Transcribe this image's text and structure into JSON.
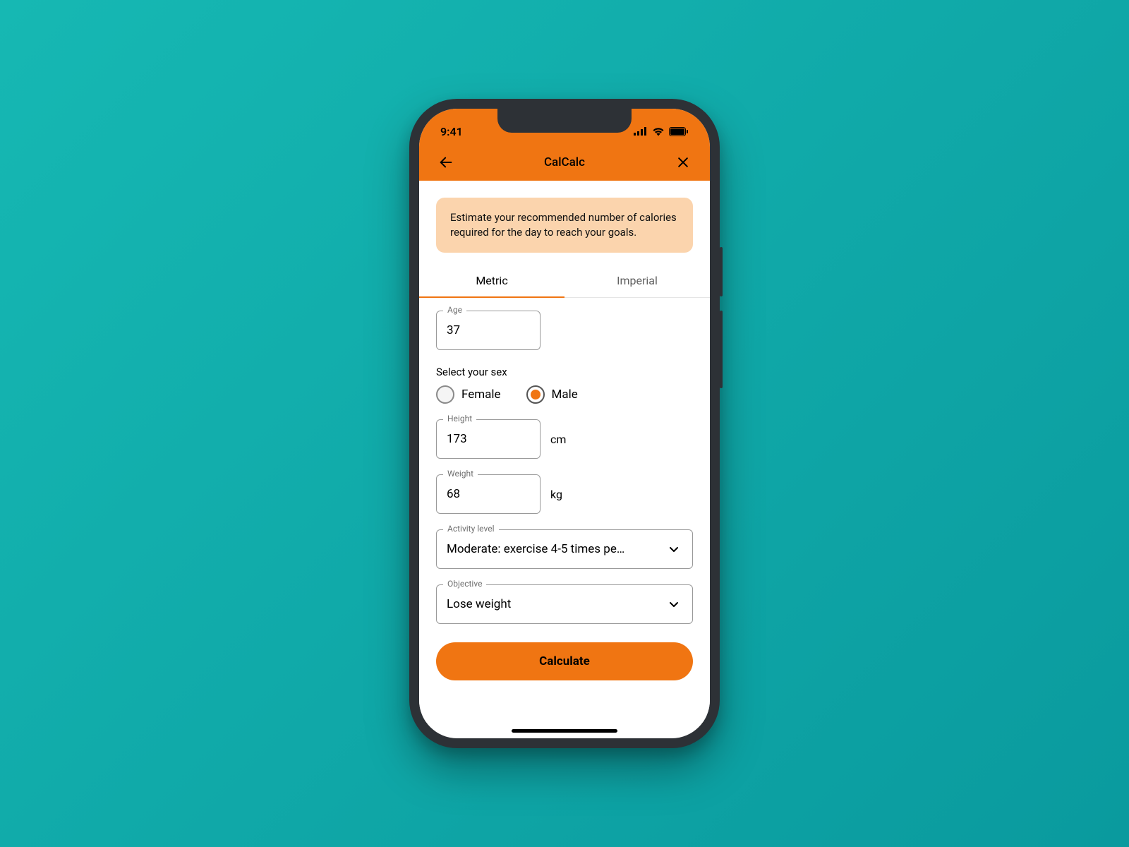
{
  "status": {
    "time": "9:41"
  },
  "nav": {
    "title": "CalCalc"
  },
  "info": {
    "text": "Estimate your recommended number of calories required for the day to reach your goals."
  },
  "tabs": {
    "metric": "Metric",
    "imperial": "Imperial",
    "active": "metric"
  },
  "form": {
    "age_label": "Age",
    "age_value": "37",
    "sex_label": "Select your sex",
    "sex_female": "Female",
    "sex_male": "Male",
    "sex_selected": "male",
    "height_label": "Height",
    "height_value": "173",
    "height_unit": "cm",
    "weight_label": "Weight",
    "weight_value": "68",
    "weight_unit": "kg",
    "activity_label": "Activity level",
    "activity_value": "Moderate: exercise 4-5 times pe…",
    "objective_label": "Objective",
    "objective_value": "Lose weight"
  },
  "cta": {
    "label": "Calculate"
  },
  "colors": {
    "accent": "#f07512",
    "info_bg": "#fbd4ad",
    "page_bg": "#13b2b1"
  }
}
